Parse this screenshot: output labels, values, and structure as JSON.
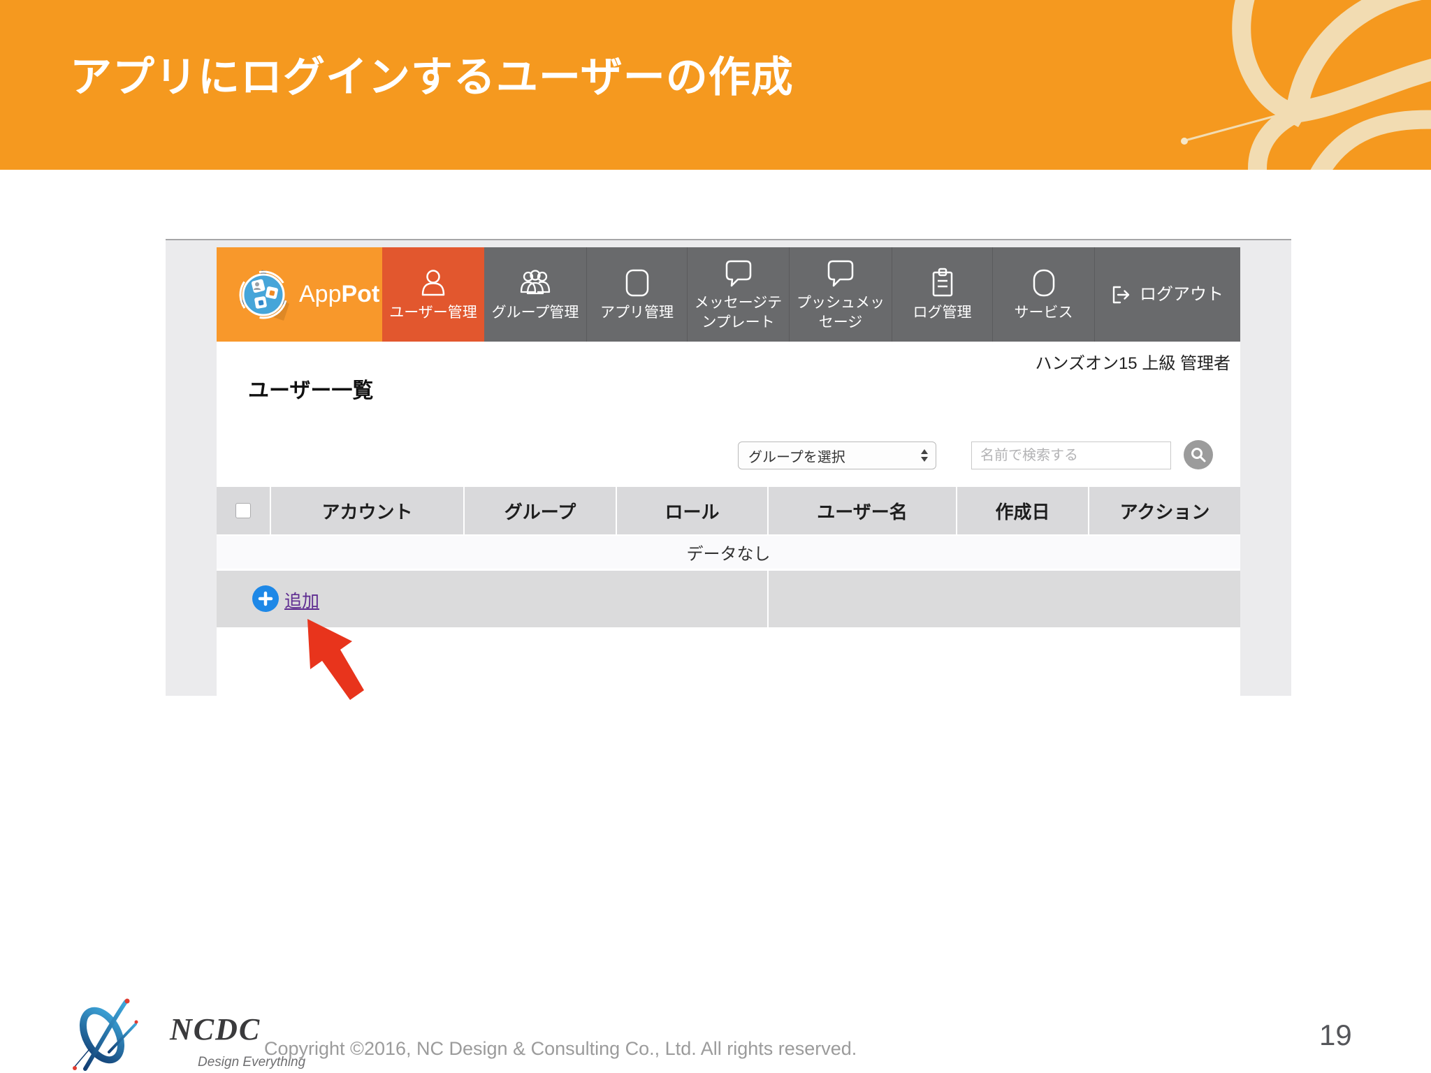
{
  "slide": {
    "title": "アプリにログインするユーザーの作成",
    "page_number": "19",
    "copyright": "Copyright ©2016, NC Design & Consulting Co., Ltd. All rights reserved.",
    "footer_logo": {
      "name": "NCDC",
      "tagline": "Design Everything"
    }
  },
  "colors": {
    "band_orange": "#F5991F",
    "brand_orange": "#F8982B",
    "nav_gray": "#696A6C",
    "selected_tab_red": "#E2572E",
    "add_button_blue": "#1E88E7",
    "link_purple": "#5F2D91",
    "arrow_red": "#E8341C",
    "panel_gray": "#EBEBED"
  },
  "app": {
    "brand": {
      "app": "App",
      "pot": "Pot"
    },
    "nav": [
      {
        "label": "ユーザー管理",
        "icon": "user-icon",
        "selected": true
      },
      {
        "label": "グループ管理",
        "icon": "group-icon",
        "selected": false
      },
      {
        "label": "アプリ管理",
        "icon": "app-icon",
        "selected": false
      },
      {
        "label": "メッセージテンプレート",
        "icon": "message-template-icon",
        "selected": false
      },
      {
        "label": "プッシュメッセージ",
        "icon": "push-message-icon",
        "selected": false
      },
      {
        "label": "ログ管理",
        "icon": "log-icon",
        "selected": false
      },
      {
        "label": "サービス",
        "icon": "service-icon",
        "selected": false
      }
    ],
    "logout_label": "ログアウト",
    "user_info": "ハンズオン15 上級 管理者",
    "page_title": "ユーザー一覧",
    "filters": {
      "group_select_value": "グループを選択",
      "search_placeholder": "名前で検索する"
    },
    "table": {
      "columns": [
        "アカウント",
        "グループ",
        "ロール",
        "ユーザー名",
        "作成日",
        "アクション"
      ],
      "empty_message": "データなし",
      "add_label": "追加"
    }
  }
}
